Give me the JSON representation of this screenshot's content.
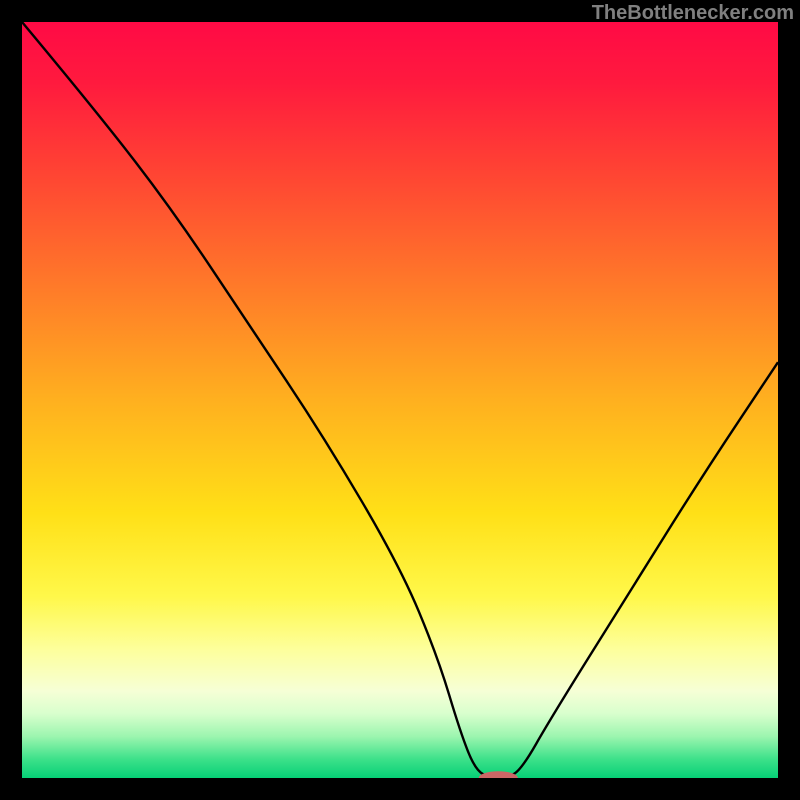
{
  "attribution": "TheBottlenecker.com",
  "chart_data": {
    "type": "line",
    "title": "",
    "xlabel": "",
    "ylabel": "",
    "xlim": [
      0,
      100
    ],
    "ylim": [
      0,
      100
    ],
    "series": [
      {
        "name": "bottleneck-curve",
        "x": [
          0,
          10,
          20,
          30,
          40,
          50,
          55,
          58,
          60,
          62,
          64,
          66,
          70,
          80,
          90,
          100
        ],
        "values": [
          100,
          88,
          75,
          60,
          45,
          28,
          16,
          6,
          1,
          0,
          0,
          1,
          8,
          24,
          40,
          55
        ]
      }
    ],
    "marker": {
      "x": 63,
      "y": 0,
      "color": "#cc6666",
      "radius_x": 2.6,
      "radius_y": 0.9
    },
    "gradient_stops": [
      {
        "offset": 0.0,
        "color": "#ff0a45"
      },
      {
        "offset": 0.08,
        "color": "#ff1a3e"
      },
      {
        "offset": 0.2,
        "color": "#ff4433"
      },
      {
        "offset": 0.35,
        "color": "#ff7a29"
      },
      {
        "offset": 0.5,
        "color": "#ffb01f"
      },
      {
        "offset": 0.65,
        "color": "#ffe017"
      },
      {
        "offset": 0.76,
        "color": "#fff84a"
      },
      {
        "offset": 0.83,
        "color": "#fdff9c"
      },
      {
        "offset": 0.885,
        "color": "#f6ffd6"
      },
      {
        "offset": 0.915,
        "color": "#d8ffcd"
      },
      {
        "offset": 0.945,
        "color": "#9cf5af"
      },
      {
        "offset": 0.975,
        "color": "#3de18a"
      },
      {
        "offset": 1.0,
        "color": "#06d076"
      }
    ]
  }
}
